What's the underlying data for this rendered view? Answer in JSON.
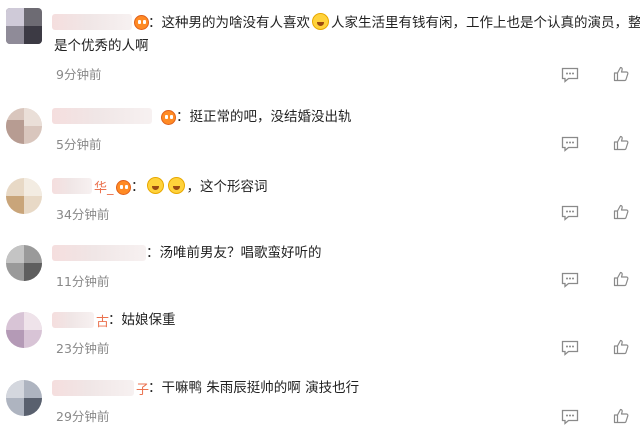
{
  "comments": [
    {
      "name_tail": "",
      "text_pre": "：这种男的为啥没有人喜欢",
      "text_post": "人家生活里有钱有闲，工作上也是个认真的演员，整体",
      "text_line2": "是个优秀的人啊",
      "emoji": "laughing-emoji",
      "time": "9分钟前"
    },
    {
      "name_tail": "",
      "text": "：挺正常的吧，没结婚没出轨",
      "time": "5分钟前"
    },
    {
      "name_tail": "华_",
      "text_pre": "：",
      "text_post": "，这个形容词",
      "emoji": "laughing-emoji",
      "time": "34分钟前"
    },
    {
      "name_tail": "",
      "text": "：汤唯前男友？唱歌蛮好听的",
      "time": "11分钟前"
    },
    {
      "name_tail": "古",
      "text": "：姑娘保重",
      "time": "23分钟前"
    },
    {
      "name_tail": "子",
      "text": "：干嘛鸭 朱雨辰挺帅的啊 演技也行",
      "time": "29分钟前"
    }
  ],
  "icons": {
    "comment": "comment-icon",
    "like": "thumbs-up-icon",
    "badge": "member-badge-icon"
  },
  "colors": {
    "accent_name": "#eb7350",
    "time": "#888888",
    "text": "#222222"
  }
}
